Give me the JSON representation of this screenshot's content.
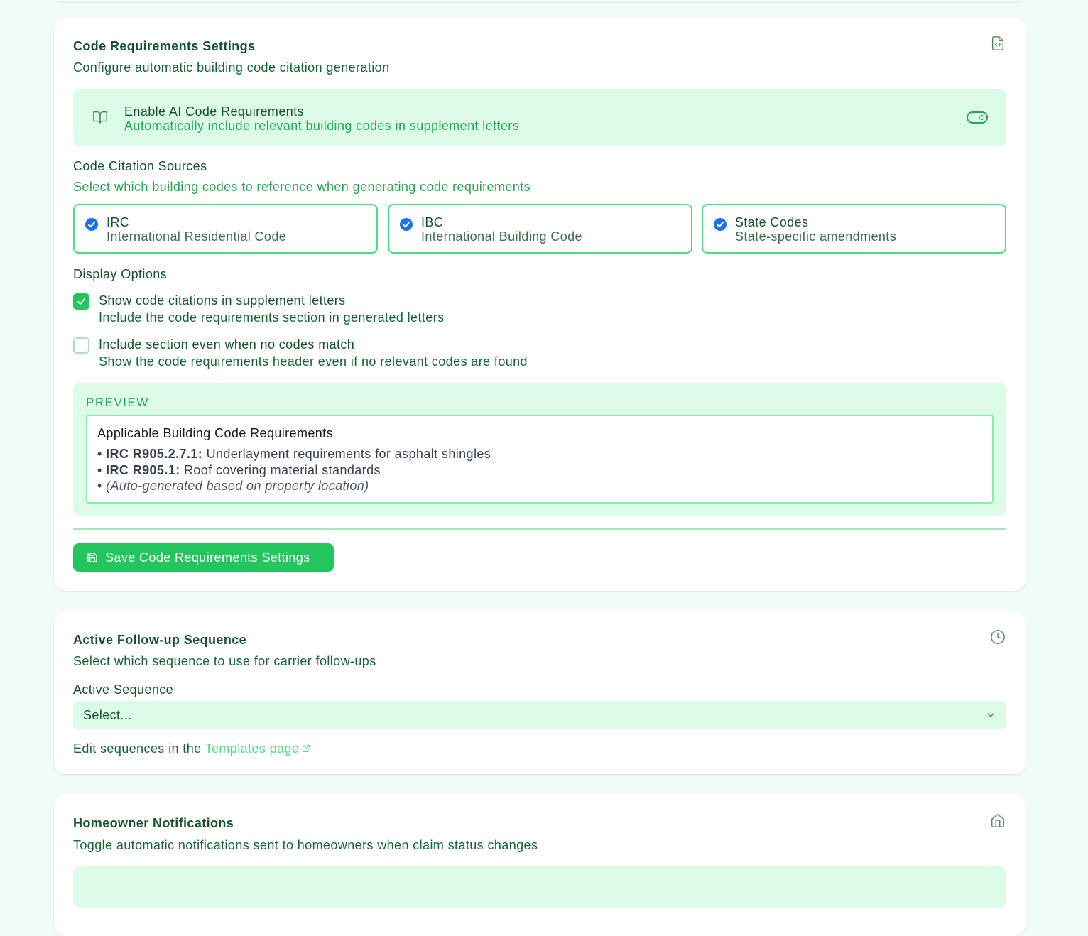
{
  "code_requirements": {
    "title": "Code Requirements Settings",
    "subtitle": "Configure automatic building code citation generation",
    "header_icon": "file-code-icon",
    "enable_toggle": {
      "title": "Enable AI Code Requirements",
      "description": "Automatically include relevant building codes in supplement letters",
      "icon": "book-open-icon",
      "state": "on"
    },
    "sources": {
      "label": "Code Citation Sources",
      "description": "Select which building codes to reference when generating code requirements",
      "items": [
        {
          "name": "IRC",
          "description": "International Residential Code",
          "checked": true
        },
        {
          "name": "IBC",
          "description": "International Building Code",
          "checked": true
        },
        {
          "name": "State Codes",
          "description": "State-specific amendments",
          "checked": true
        }
      ]
    },
    "display_options": {
      "label": "Display Options",
      "items": [
        {
          "title": "Show code citations in supplement letters",
          "description": "Include the code requirements section in generated letters",
          "checked": true
        },
        {
          "title": "Include section even when no codes match",
          "description": "Show the code requirements header even if no relevant codes are found",
          "checked": false
        }
      ]
    },
    "preview": {
      "label": "PREVIEW",
      "heading": "Applicable Building Code Requirements",
      "items": [
        {
          "bullet": "•",
          "code": "IRC R905.2.7.1:",
          "text": "Underlayment requirements for asphalt shingles"
        },
        {
          "bullet": "•",
          "code": "IRC R905.1:",
          "text": "Roof covering material standards"
        },
        {
          "bullet": "•",
          "note": "(Auto-generated based on property location)"
        }
      ]
    },
    "save_button": {
      "label": "Save Code Requirements Settings",
      "icon": "save-icon"
    }
  },
  "follow_up": {
    "title": "Active Follow-up Sequence",
    "subtitle": "Select which sequence to use for carrier follow-ups",
    "header_icon": "clock-icon",
    "select_label": "Active Sequence",
    "select_value": "Select...",
    "hint_prefix": "Edit sequences in the ",
    "hint_link": "Templates page"
  },
  "homeowner": {
    "title": "Homeowner Notifications",
    "subtitle": "Toggle automatic notifications sent to homeowners when claim status changes",
    "header_icon": "home-icon"
  },
  "colors": {
    "page_bg": "#f0fdf4",
    "accent": "#22c55e",
    "panel_bg": "#dcfce7",
    "checkbox_blue": "#1a73e8"
  }
}
